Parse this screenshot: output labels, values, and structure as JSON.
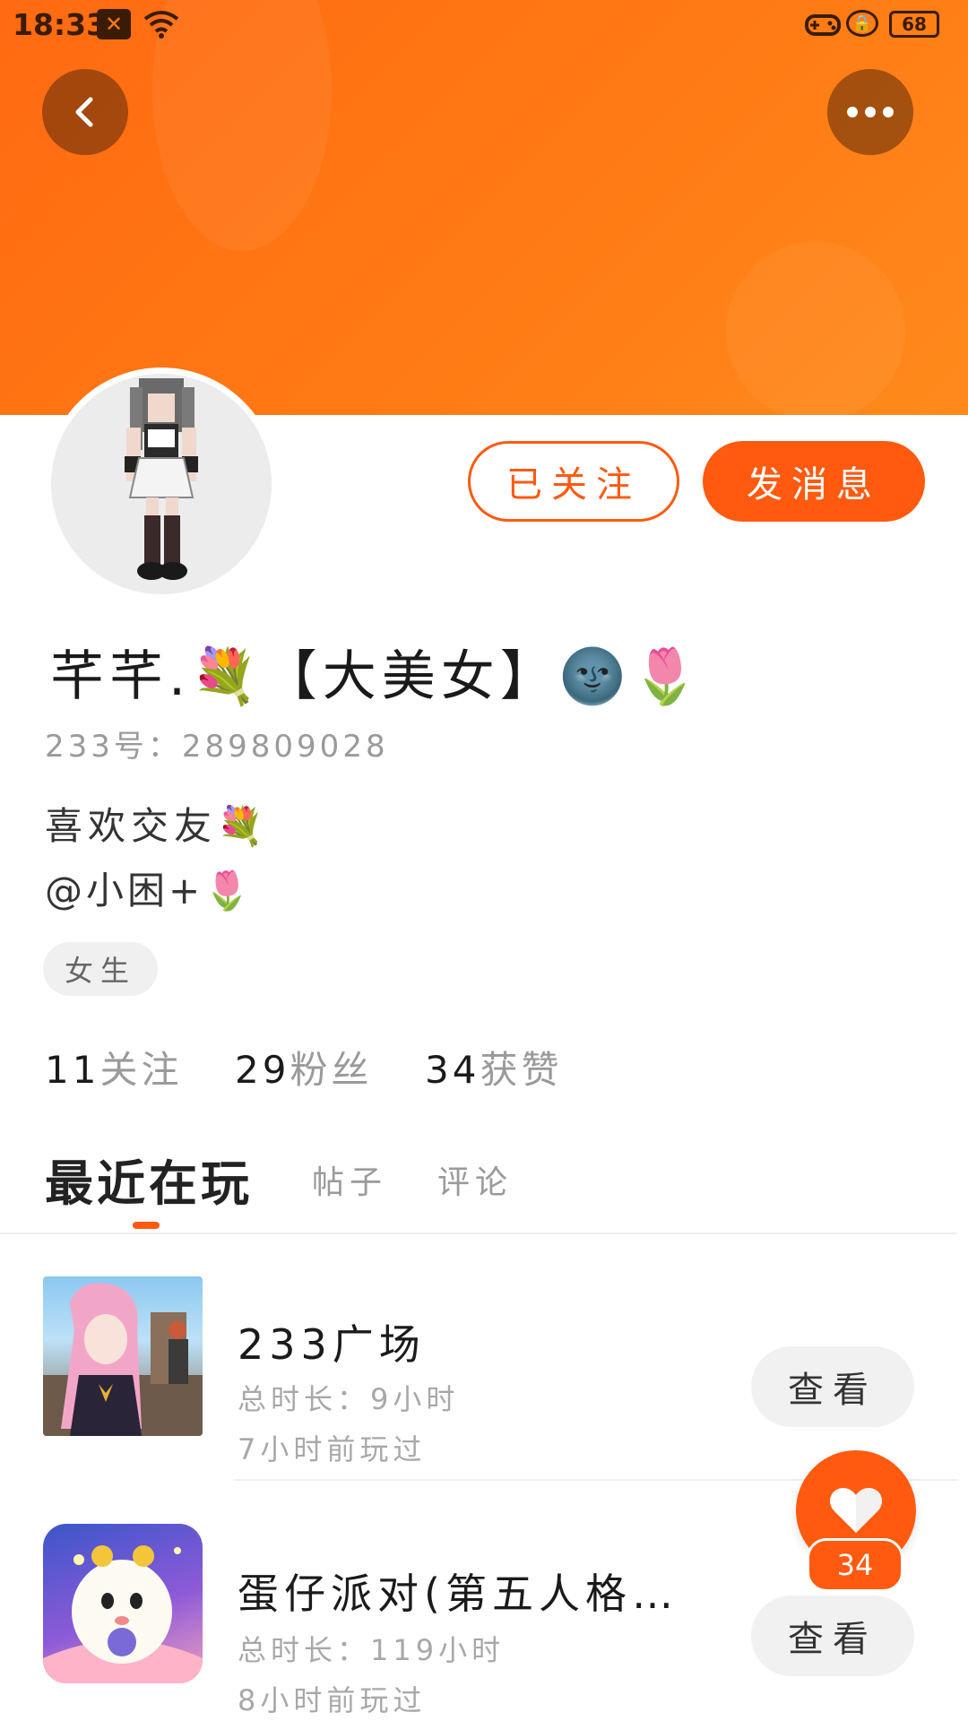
{
  "status_bar": {
    "time": "18:33",
    "battery": "68",
    "icons": [
      "notification-x-icon",
      "wifi-icon",
      "game-controller-icon",
      "rotation-lock-icon",
      "battery-icon"
    ]
  },
  "header": {
    "accent_color": "#ff6a12",
    "back_icon": "chevron-left-icon",
    "more_icon": "more-dots-icon"
  },
  "profile": {
    "nickname": "芊芊.💐【大美女】🌚🌷",
    "id_line": "233号：289809028",
    "bio_line1": "喜欢交友💐",
    "bio_line2": "@小困+🌷",
    "gender_tag": "女生",
    "followed_label": "已关注",
    "message_label": "发消息"
  },
  "stats": [
    {
      "num": "11",
      "label": "关注"
    },
    {
      "num": "29",
      "label": "粉丝"
    },
    {
      "num": "34",
      "label": "获赞"
    }
  ],
  "tabs": [
    {
      "label": "最近在玩",
      "active": true
    },
    {
      "label": "帖子",
      "active": false
    },
    {
      "label": "评论",
      "active": false
    }
  ],
  "games": [
    {
      "title": "233广场",
      "duration": "总时长：9小时",
      "last_played": "7小时前玩过",
      "button": "查看"
    },
    {
      "title": "蛋仔派对(第五人格…",
      "duration": "总时长：119小时",
      "last_played": "8小时前玩过",
      "button": "查看"
    }
  ],
  "like_fab": {
    "count": "34",
    "icon": "heart-icon"
  }
}
